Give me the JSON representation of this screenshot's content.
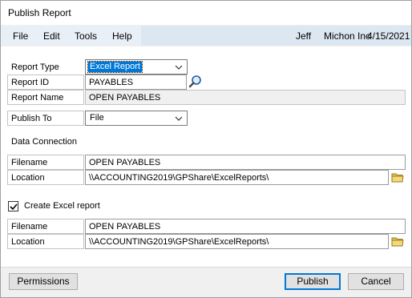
{
  "window": {
    "title": "Publish Report"
  },
  "menu": {
    "items": [
      "File",
      "Edit",
      "Tools",
      "Help"
    ],
    "user": "Jeff",
    "company": "Michon Inc",
    "date": "4/15/2021"
  },
  "form": {
    "report_type": {
      "label": "Report Type",
      "value": "Excel Report"
    },
    "report_id": {
      "label": "Report ID",
      "value": "PAYABLES"
    },
    "report_name": {
      "label": "Report Name",
      "value": "OPEN PAYABLES"
    },
    "publish_to": {
      "label": "Publish To",
      "value": "File"
    },
    "data_connection": {
      "heading": "Data Connection",
      "filename_label": "Filename",
      "filename": "OPEN PAYABLES",
      "location_label": "Location",
      "location": "\\\\ACCOUNTING2019\\GPShare\\ExcelReports\\"
    },
    "excel": {
      "checkbox_label": "Create Excel report",
      "checked": true,
      "filename_label": "Filename",
      "filename": "OPEN PAYABLES",
      "location_label": "Location",
      "location": "\\\\ACCOUNTING2019\\GPShare\\ExcelReports\\"
    }
  },
  "buttons": {
    "permissions": "Permissions",
    "publish": "Publish",
    "cancel": "Cancel"
  },
  "icons": {
    "lookup": "magnifier-icon",
    "folder": "folder-icon",
    "dropdown": "chevron-down-icon",
    "check": "checkmark-icon"
  },
  "colors": {
    "accent": "#0078d7",
    "menubar": "#dde7f1"
  }
}
